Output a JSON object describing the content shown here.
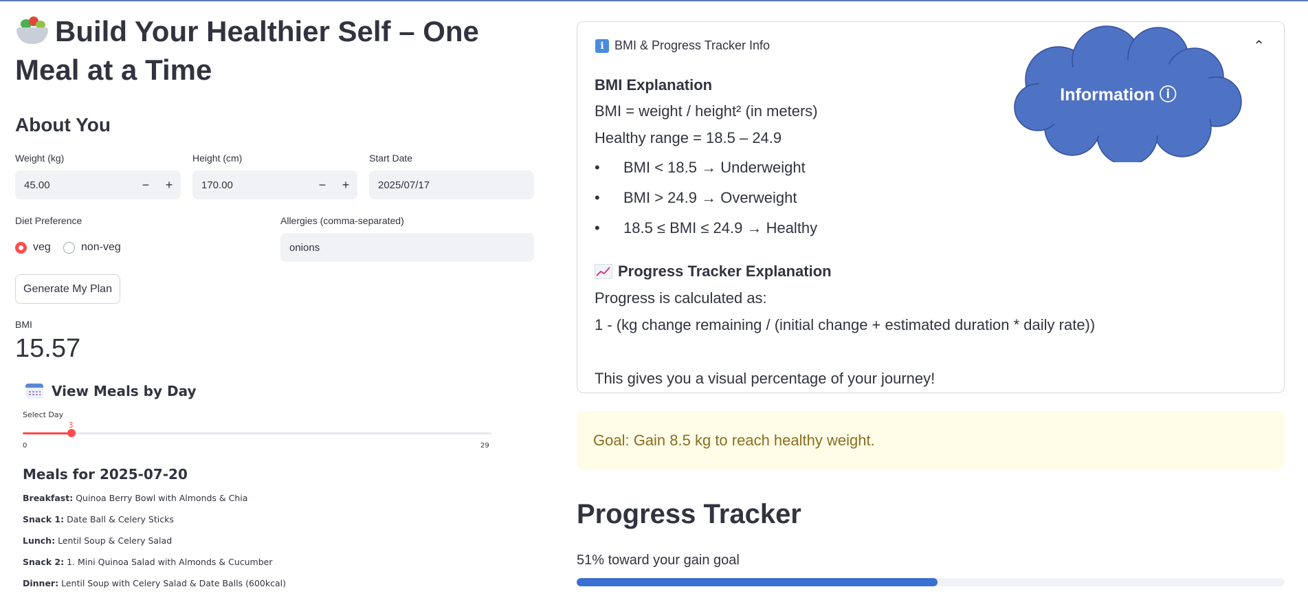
{
  "header": {
    "title_line1": "Build Your Healthier Self – One",
    "title_line2": "Meal at a Time",
    "title_icon": "salad-bowl-icon"
  },
  "about": {
    "heading": "About You",
    "weight": {
      "label": "Weight (kg)",
      "value": "45.00"
    },
    "height": {
      "label": "Height (cm)",
      "value": "170.00"
    },
    "start_date": {
      "label": "Start Date",
      "value": "2025/07/17"
    },
    "diet": {
      "label": "Diet Preference",
      "options": [
        "veg",
        "non-veg"
      ],
      "selected": "veg"
    },
    "allergies": {
      "label": "Allergies (comma-separated)",
      "value": "onions"
    },
    "generate_button": "Generate My Plan",
    "stepper_minus": "−",
    "stepper_plus": "+"
  },
  "bmi": {
    "label": "BMI",
    "value": "15.57"
  },
  "meals": {
    "heading": "View Meals by Day",
    "slider": {
      "label": "Select Day",
      "min": "0",
      "max": "29",
      "value": "3"
    },
    "date_heading": "Meals for 2025-07-20",
    "items": [
      {
        "label": "Breakfast:",
        "text": "Quinoa Berry Bowl with Almonds & Chia"
      },
      {
        "label": "Snack 1:",
        "text": "Date Ball & Celery Sticks"
      },
      {
        "label": "Lunch:",
        "text": "Lentil Soup & Celery Salad"
      },
      {
        "label": "Snack 2:",
        "text": "1. Mini Quinoa Salad with Almonds & Cucumber"
      },
      {
        "label": "Dinner:",
        "text": "Lentil Soup with Celery Salad & Date Balls (600kcal)"
      }
    ]
  },
  "info": {
    "expander_title": "BMI & Progress Tracker Info",
    "bmi_heading": "BMI Explanation",
    "formula": "BMI = weight / height² (in meters)",
    "healthy_range": "Healthy range = 18.5 – 24.9",
    "bullets": [
      "BMI < 18.5 → Underweight",
      "BMI > 24.9 → Overweight",
      "18.5 ≤ BMI ≤ 24.9 → Healthy"
    ],
    "progress_heading": "Progress Tracker Explanation",
    "progress_calc": "Progress is calculated as:",
    "progress_formula": "1 - (kg change remaining / (initial change + estimated duration * daily rate))",
    "progress_note": "This gives you a visual percentage of your journey!",
    "cloud_label": "Information ⓘ"
  },
  "goal": {
    "text": "Goal: Gain 8.5 kg to reach healthy weight."
  },
  "progress": {
    "title": "Progress Tracker",
    "caption": "51% toward your gain goal",
    "fraction": 0.51
  },
  "colors": {
    "accent": "#ff4b4b",
    "progress_fill": "#3b6fd1",
    "cloud_fill": "#4e72c4",
    "goal_bg": "#fffce7"
  }
}
